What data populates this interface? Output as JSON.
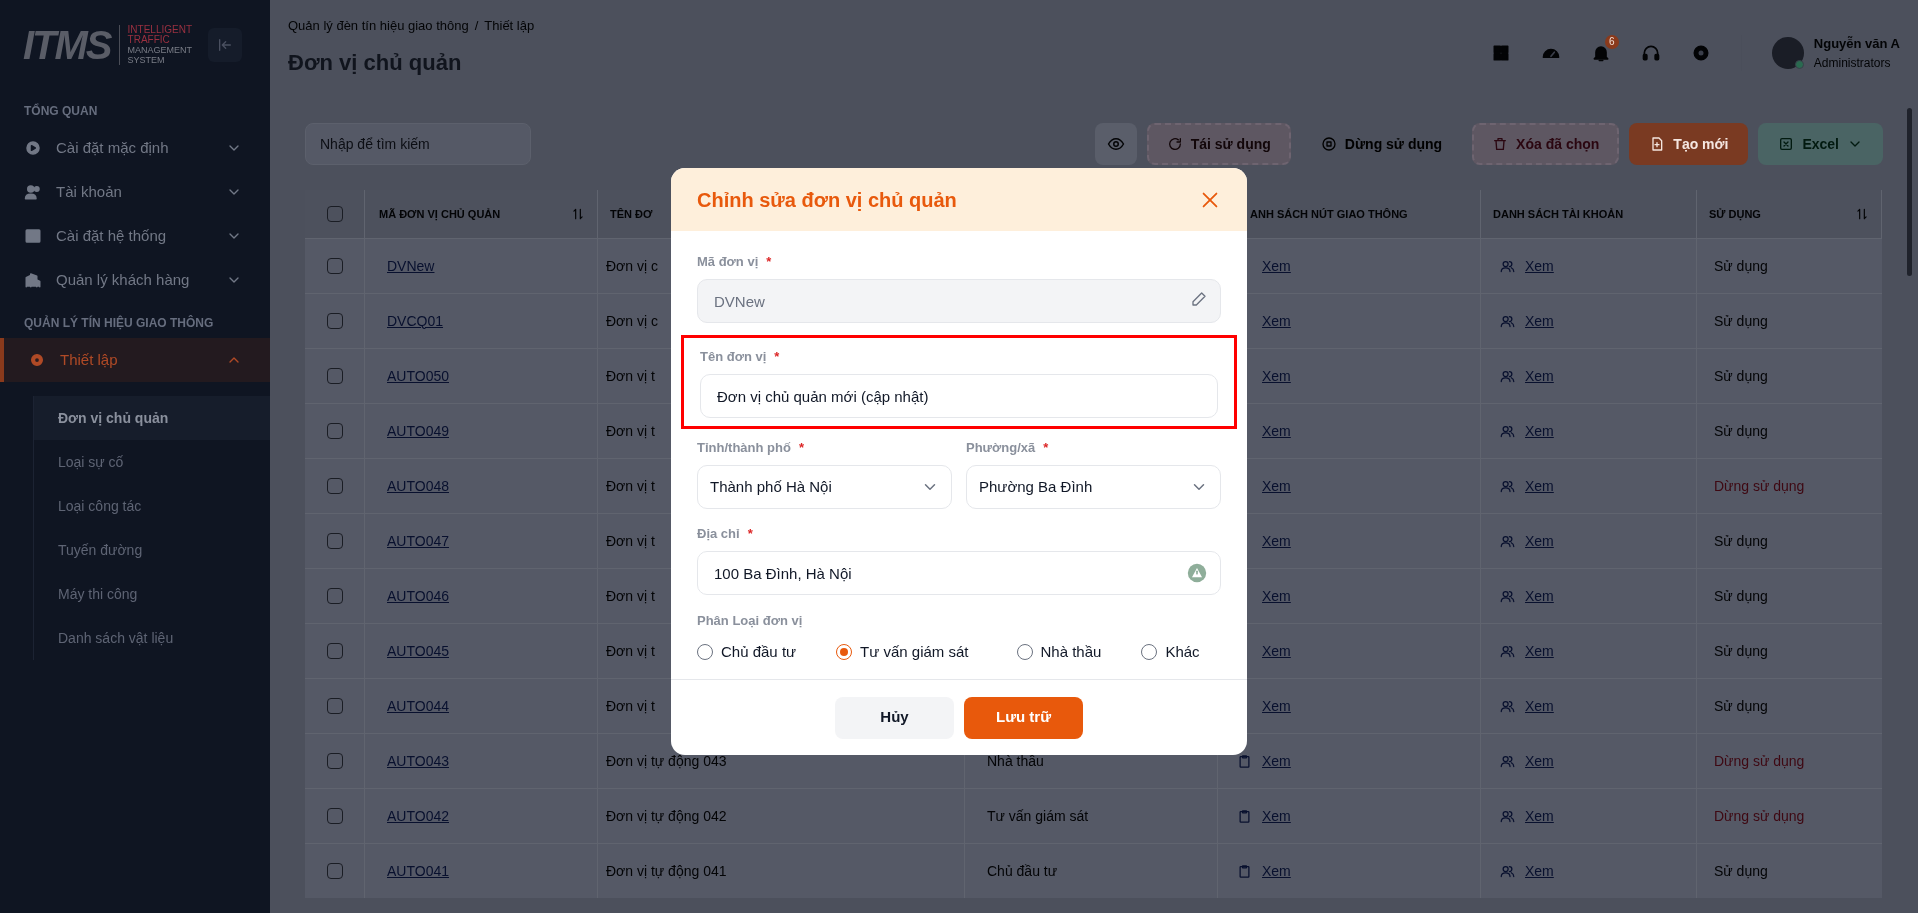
{
  "sidebar": {
    "logo": {
      "mark": "ITMS",
      "tagline": [
        "INTELLIGENT",
        "TRAFFIC",
        "MANAGEMENT",
        "SYSTEM"
      ]
    },
    "sections": [
      {
        "title": "TỔNG QUAN",
        "items": [
          {
            "label": "Cài đặt mặc định",
            "expanded": false,
            "selected": false
          },
          {
            "label": "Tài khoản",
            "expanded": false,
            "selected": false
          },
          {
            "label": "Cài đặt hệ thống",
            "expanded": false,
            "selected": false
          },
          {
            "label": "Quản lý khách hàng",
            "expanded": false,
            "selected": false
          }
        ]
      },
      {
        "title": "QUẢN LÝ TÍN HIỆU GIAO THÔNG",
        "items": [
          {
            "label": "Thiết lập",
            "expanded": true,
            "selected": true,
            "children": [
              {
                "label": "Đơn vị chủ quản",
                "selected": true
              },
              {
                "label": "Loại sự cố",
                "selected": false
              },
              {
                "label": "Loại công tác",
                "selected": false
              },
              {
                "label": "Tuyến đường",
                "selected": false
              },
              {
                "label": "Máy thi công",
                "selected": false
              },
              {
                "label": "Danh sách vật liệu",
                "selected": false
              }
            ]
          }
        ]
      }
    ]
  },
  "header": {
    "breadcrumb": [
      "Quản lý đèn tín hiệu giao thông",
      "Thiết lập"
    ],
    "separator": "/",
    "title": "Đơn vị chủ quản",
    "notification_count": "6",
    "user": {
      "name": "Nguyễn văn A",
      "role": "Administrators"
    }
  },
  "toolbar": {
    "search": {
      "placeholder": "Nhập để tìm kiếm"
    },
    "buttons": [
      {
        "kind": "reuse",
        "label": "Tái sử dụng",
        "disabled": true
      },
      {
        "kind": "stop",
        "label": "Dừng sử dụng",
        "disabled": false
      },
      {
        "kind": "delete",
        "label": "Xóa đã chọn",
        "disabled": true
      },
      {
        "kind": "create",
        "label": "Tạo mới",
        "disabled": false
      },
      {
        "kind": "export",
        "label": "Excel",
        "disabled": false
      }
    ]
  },
  "table": {
    "all_selected": false,
    "columns": [
      {
        "label": "MÃ ĐƠN VỊ CHỦ QUẢN",
        "sortable": true
      },
      {
        "label": "TÊN ĐƠ",
        "sortable": false
      },
      {
        "label": "ANH SÁCH NÚT GIAO THÔNG",
        "sortable": false
      },
      {
        "label": "DANH SÁCH TÀI KHOẢN",
        "sortable": false
      },
      {
        "label": "SỬ DỤNG",
        "sortable": true
      }
    ],
    "rows": [
      {
        "checked": false,
        "code": "DVNew",
        "name": "Đơn vị c",
        "junctions": "Xem",
        "accounts": "Xem",
        "status": "Sử dụng",
        "active": true
      },
      {
        "checked": false,
        "code": "DVCQ01",
        "name": "Đơn vị c",
        "junctions": "Xem",
        "accounts": "Xem",
        "status": "Sử dụng",
        "active": true
      },
      {
        "checked": false,
        "code": "AUTO050",
        "name": "Đơn vị t",
        "junctions": "Xem",
        "accounts": "Xem",
        "status": "Sử dụng",
        "active": true
      },
      {
        "checked": false,
        "code": "AUTO049",
        "name": "Đơn vị t",
        "junctions": "Xem",
        "accounts": "Xem",
        "status": "Sử dụng",
        "active": true
      },
      {
        "checked": false,
        "code": "AUTO048",
        "name": "Đơn vị t",
        "junctions": "Xem",
        "accounts": "Xem",
        "status": "Dừng sử dụng",
        "active": false
      },
      {
        "checked": false,
        "code": "AUTO047",
        "name": "Đơn vị t",
        "junctions": "Xem",
        "accounts": "Xem",
        "status": "Sử dụng",
        "active": true
      },
      {
        "checked": false,
        "code": "AUTO046",
        "name": "Đơn vị t",
        "junctions": "Xem",
        "accounts": "Xem",
        "status": "Sử dụng",
        "active": true
      },
      {
        "checked": false,
        "code": "AUTO045",
        "name": "Đơn vị t",
        "junctions": "Xem",
        "accounts": "Xem",
        "status": "Sử dụng",
        "active": true
      },
      {
        "checked": false,
        "code": "AUTO044",
        "name": "Đơn vị t",
        "junctions": "Xem",
        "accounts": "Xem",
        "status": "Sử dụng",
        "active": true
      },
      {
        "checked": false,
        "code": "AUTO043",
        "name": "Đơn vị tự động 043",
        "type": "Nhà thầu",
        "junctions": "Xem",
        "accounts": "Xem",
        "status": "Dừng sử dụng",
        "active": false
      },
      {
        "checked": false,
        "code": "AUTO042",
        "name": "Đơn vị tự động 042",
        "type": "Tư vấn giám sát",
        "junctions": "Xem",
        "accounts": "Xem",
        "status": "Dừng sử dụng",
        "active": false
      },
      {
        "checked": false,
        "code": "AUTO041",
        "name": "Đơn vị tự động 041",
        "type": "Chủ đầu tư",
        "junctions": "Xem",
        "accounts": "Xem",
        "status": "Sử dụng",
        "active": true
      }
    ]
  },
  "modal": {
    "title": "Chỉnh sửa đơn vị chủ quản",
    "code": {
      "label": "Mã đơn vị",
      "required": "*",
      "value": "DVNew",
      "disabled": true
    },
    "name": {
      "label": "Tên đơn vị",
      "required": "*",
      "value": "Đơn vị chủ quản mới (cập nhật)",
      "highlighted": true
    },
    "province": {
      "label": "Tỉnh/thành phố",
      "required": "*",
      "value": "Thành phố Hà Nội"
    },
    "ward": {
      "label": "Phường/xã",
      "required": "*",
      "value": "Phường Ba Đình"
    },
    "address": {
      "label": "Địa chỉ",
      "required": "*",
      "value": "100 Ba Đình, Hà Nội"
    },
    "category": {
      "label": "Phân Loại đơn vị",
      "options": [
        {
          "label": "Chủ đầu tư",
          "selected": false
        },
        {
          "label": "Tư vấn giám sát",
          "selected": true
        },
        {
          "label": "Nhà thầu",
          "selected": false
        },
        {
          "label": "Khác",
          "selected": false
        }
      ]
    },
    "buttons": [
      {
        "kind": "cancel",
        "label": "Hủy"
      },
      {
        "kind": "save",
        "label": "Lưu trữ"
      }
    ]
  }
}
